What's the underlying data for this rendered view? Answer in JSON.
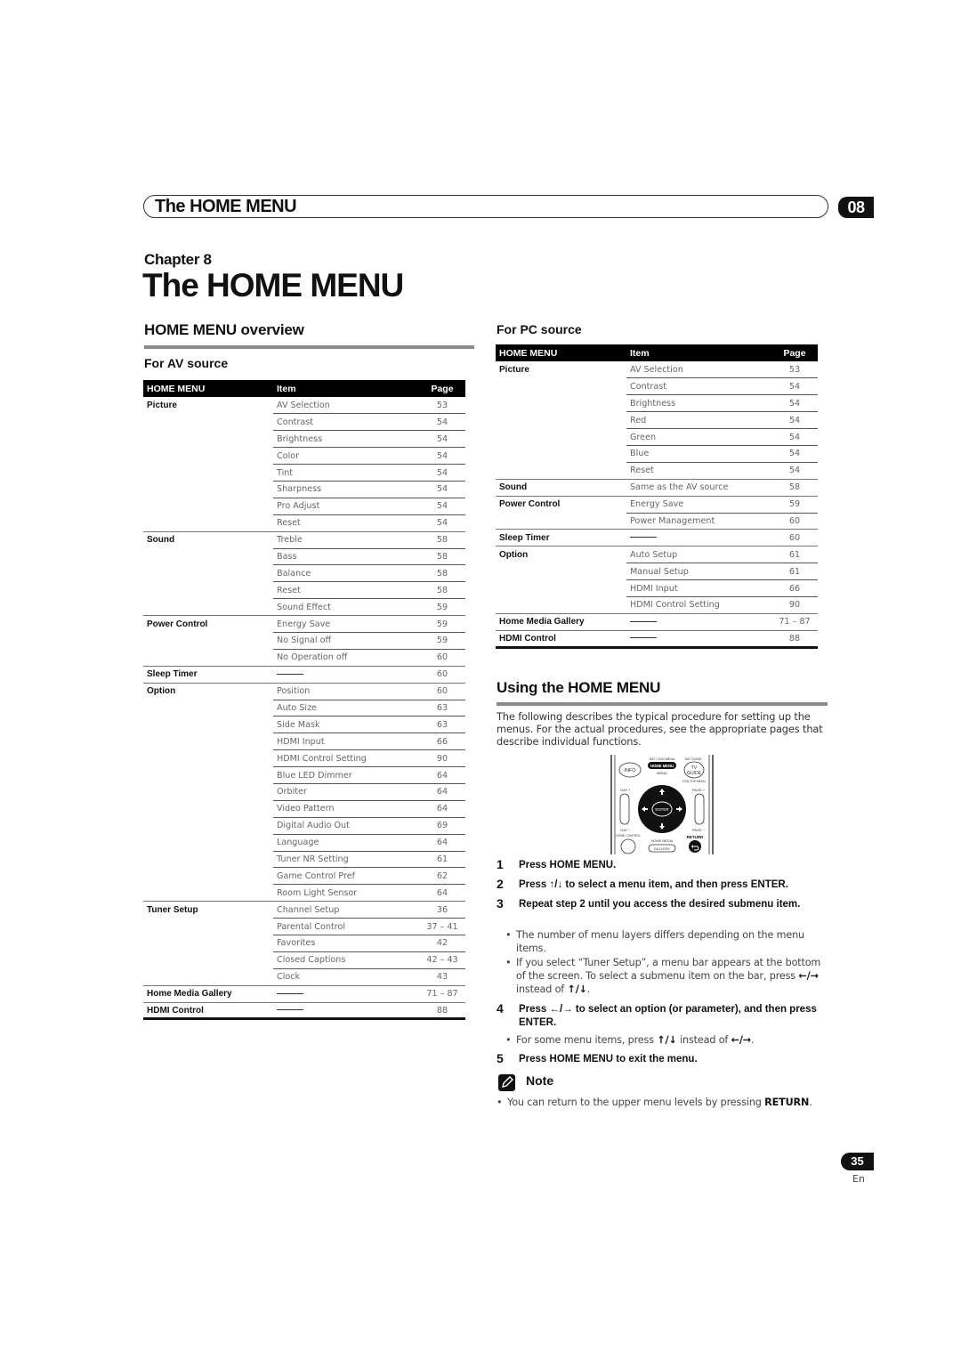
{
  "header": {
    "running_title": "The HOME MENU",
    "chapter_tab": "08"
  },
  "chapter": {
    "label": "Chapter 8",
    "title": "The HOME MENU"
  },
  "overview": {
    "heading": "HOME MENU overview",
    "av_heading": "For AV source",
    "pc_heading": "For PC source",
    "columns": [
      "HOME MENU",
      "Item",
      "Page"
    ],
    "av_rows": [
      {
        "menu": "Picture",
        "item": "AV Selection",
        "page": "53"
      },
      {
        "menu": "",
        "item": "Contrast",
        "page": "54"
      },
      {
        "menu": "",
        "item": "Brightness",
        "page": "54"
      },
      {
        "menu": "",
        "item": "Color",
        "page": "54"
      },
      {
        "menu": "",
        "item": "Tint",
        "page": "54"
      },
      {
        "menu": "",
        "item": "Sharpness",
        "page": "54"
      },
      {
        "menu": "",
        "item": "Pro Adjust",
        "page": "54"
      },
      {
        "menu": "",
        "item": "Reset",
        "page": "54"
      },
      {
        "menu": "Sound",
        "item": "Treble",
        "page": "58"
      },
      {
        "menu": "",
        "item": "Bass",
        "page": "58"
      },
      {
        "menu": "",
        "item": "Balance",
        "page": "58"
      },
      {
        "menu": "",
        "item": "Reset",
        "page": "58"
      },
      {
        "menu": "",
        "item": "Sound Effect",
        "page": "59"
      },
      {
        "menu": "Power Control",
        "item": "Energy Save",
        "page": "59"
      },
      {
        "menu": "",
        "item": "No Signal off",
        "page": "59"
      },
      {
        "menu": "",
        "item": "No Operation off",
        "page": "60"
      },
      {
        "menu": "Sleep Timer",
        "item": "",
        "page": "60"
      },
      {
        "menu": "Option",
        "item": "Position",
        "page": "60"
      },
      {
        "menu": "",
        "item": "Auto Size",
        "page": "63"
      },
      {
        "menu": "",
        "item": "Side Mask",
        "page": "63"
      },
      {
        "menu": "",
        "item": "HDMI Input",
        "page": "66"
      },
      {
        "menu": "",
        "item": "HDMI Control Setting",
        "page": "90"
      },
      {
        "menu": "",
        "item": "Blue LED Dimmer",
        "page": "64"
      },
      {
        "menu": "",
        "item": "Orbiter",
        "page": "64"
      },
      {
        "menu": "",
        "item": "Video Pattern",
        "page": "64"
      },
      {
        "menu": "",
        "item": "Digital Audio Out",
        "page": "69"
      },
      {
        "menu": "",
        "item": "Language",
        "page": "64"
      },
      {
        "menu": "",
        "item": "Tuner NR Setting",
        "page": "61"
      },
      {
        "menu": "",
        "item": "Game Control Pref",
        "page": "62"
      },
      {
        "menu": "",
        "item": "Room Light Sensor",
        "page": "64"
      },
      {
        "menu": "Tuner Setup",
        "item": "Channel Setup",
        "page": "36"
      },
      {
        "menu": "",
        "item": "Parental Control",
        "page": "37 – 41"
      },
      {
        "menu": "",
        "item": "Favorites",
        "page": "42"
      },
      {
        "menu": "",
        "item": "Closed Captions",
        "page": "42 – 43"
      },
      {
        "menu": "",
        "item": "Clock",
        "page": "43"
      },
      {
        "menu": "Home Media Gallery",
        "item": "",
        "page": "71 – 87"
      },
      {
        "menu": "HDMI Control",
        "item": "",
        "page": "88"
      }
    ],
    "pc_rows": [
      {
        "menu": "Picture",
        "item": "AV Selection",
        "page": "53"
      },
      {
        "menu": "",
        "item": "Contrast",
        "page": "54"
      },
      {
        "menu": "",
        "item": "Brightness",
        "page": "54"
      },
      {
        "menu": "",
        "item": "Red",
        "page": "54"
      },
      {
        "menu": "",
        "item": "Green",
        "page": "54"
      },
      {
        "menu": "",
        "item": "Blue",
        "page": "54"
      },
      {
        "menu": "",
        "item": "Reset",
        "page": "54"
      },
      {
        "menu": "Sound",
        "item": "Same as the AV source",
        "page": "58"
      },
      {
        "menu": "Power Control",
        "item": "Energy Save",
        "page": "59"
      },
      {
        "menu": "",
        "item": "Power Management",
        "page": "60"
      },
      {
        "menu": "Sleep Timer",
        "item": "",
        "page": "60"
      },
      {
        "menu": "Option",
        "item": "Auto Setup",
        "page": "61"
      },
      {
        "menu": "",
        "item": "Manual Setup",
        "page": "61"
      },
      {
        "menu": "",
        "item": "HDMI Input",
        "page": "66"
      },
      {
        "menu": "",
        "item": "HDMI Control Setting",
        "page": "90"
      },
      {
        "menu": "Home Media Gallery",
        "item": "",
        "page": "71 – 87"
      },
      {
        "menu": "HDMI Control",
        "item": "",
        "page": "88"
      }
    ]
  },
  "using": {
    "heading": "Using the HOME MENU",
    "intro": "The following describes the typical procedure for setting up the menus. For the actual procedures, see the appropriate pages that describe individual functions.",
    "remote_labels": {
      "sat_dvd_menu": "SAT / DVD MENU",
      "home_menu": "HOME MENU",
      "menu": "MENU",
      "sat_guide": "SAT GUIDE",
      "tv": "TV",
      "guide": "GUIDE",
      "dvd_top_menu": "DVD TOP MENU",
      "info": "INFO",
      "day_plus": "DAY +",
      "day_minus": "DAY −",
      "page_plus": "PAGE +",
      "page_minus": "PAGE −",
      "enter": "ENTER",
      "home_control": "HOME CONTROL",
      "home_media": "HOME MEDIA",
      "gallery": "GALLERY",
      "return": "RETURN"
    },
    "steps": [
      {
        "num": "1",
        "text": "Press HOME MENU."
      },
      {
        "num": "2",
        "pre": "Press ",
        "arrows": "↑/↓",
        "post": " to select a menu item, and then press ENTER."
      },
      {
        "num": "3",
        "text": "Repeat step 2 until you access the desired submenu item."
      },
      {
        "num": "4",
        "pre": "Press ",
        "arrows": "←/→",
        "post": " to select an option (or parameter), and then press ENTER."
      },
      {
        "num": "5",
        "text": "Press HOME MENU to exit the menu."
      }
    ],
    "bullets": {
      "layers": "The number of menu layers differs depending on the menu items.",
      "tuner_pre": "If you select “Tuner Setup”, a menu bar appears at the bottom of the screen. To select a submenu item on the bar, press ",
      "tuner_arrows1": "←/→",
      "tuner_mid": " instead of ",
      "tuner_arrows2": "↑/↓",
      "tuner_end": ".",
      "some_pre": "For some menu items, press ",
      "some_arrows1": "↑/↓",
      "some_mid": " instead of ",
      "some_arrows2": "←/→",
      "some_end": "."
    },
    "note": {
      "label": "Note",
      "text_pre": "You can return to the upper menu levels by pressing ",
      "text_bold": "RETURN",
      "text_end": "."
    }
  },
  "footer": {
    "page_number": "35",
    "language": "En"
  }
}
